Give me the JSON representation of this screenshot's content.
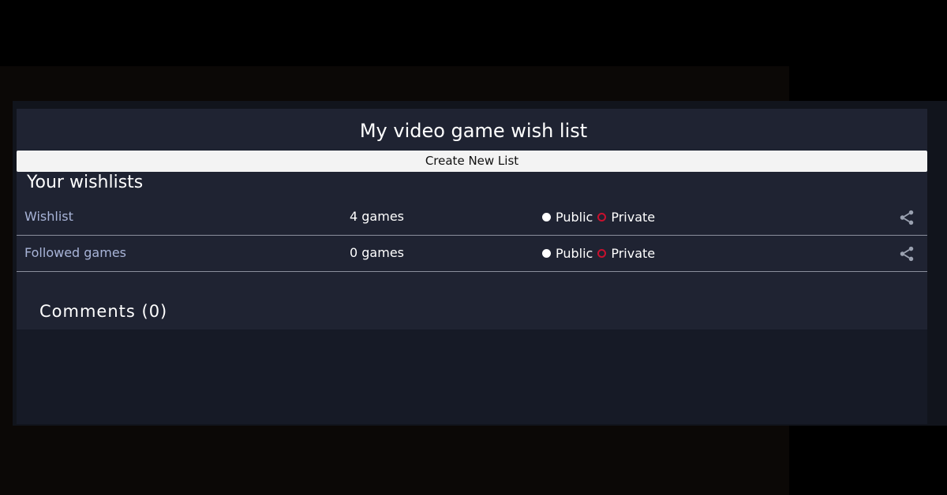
{
  "page": {
    "title": "My video game wish list"
  },
  "toolbar": {
    "create_label": "Create New List"
  },
  "wishlists": {
    "heading": "Your wishlists",
    "items": [
      {
        "name": "Wishlist",
        "count": "4 games",
        "public_label": "Public",
        "private_label": "Private",
        "selected": "private"
      },
      {
        "name": "Followed games",
        "count": "0 games",
        "public_label": "Public",
        "private_label": "Private",
        "selected": "private"
      }
    ]
  },
  "comments": {
    "heading": "Comments (0)"
  },
  "colors": {
    "accent_private": "#c8102e",
    "link": "#a8b4d8",
    "panel": "#1f2332"
  },
  "icons": {
    "share": "share-icon"
  }
}
